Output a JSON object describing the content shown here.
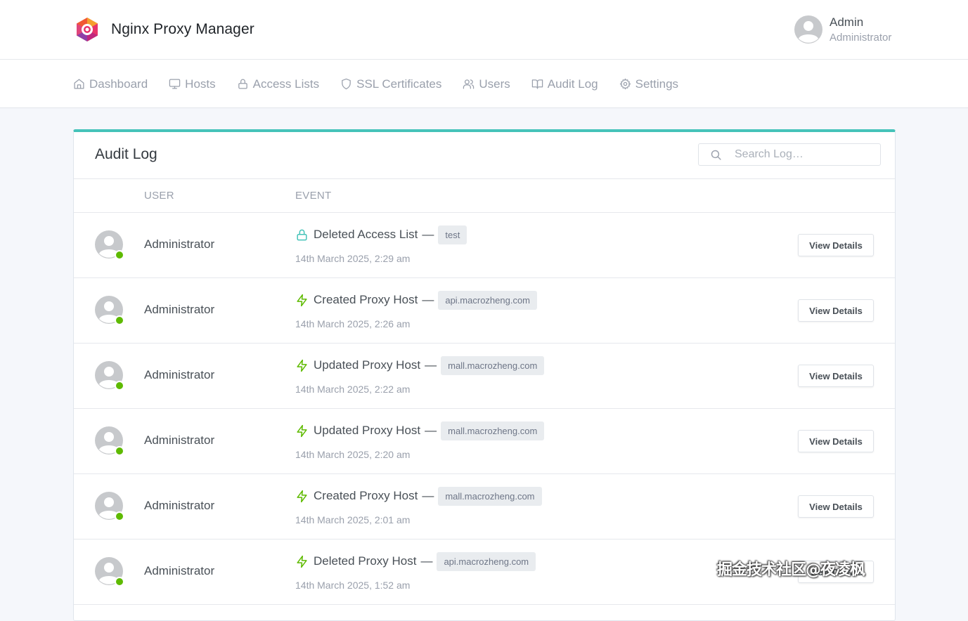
{
  "app": {
    "title": "Nginx Proxy Manager",
    "accent_color": "#45c3b9",
    "status_color": "#5eba00"
  },
  "user": {
    "name": "Admin",
    "role": "Administrator"
  },
  "nav": {
    "items": [
      {
        "label": "Dashboard",
        "icon": "home-icon"
      },
      {
        "label": "Hosts",
        "icon": "monitor-icon"
      },
      {
        "label": "Access Lists",
        "icon": "lock-icon"
      },
      {
        "label": "SSL Certificates",
        "icon": "shield-icon"
      },
      {
        "label": "Users",
        "icon": "users-icon"
      },
      {
        "label": "Audit Log",
        "icon": "book-icon"
      },
      {
        "label": "Settings",
        "icon": "gear-icon"
      }
    ]
  },
  "card": {
    "title": "Audit Log",
    "search_placeholder": "Search Log…"
  },
  "table": {
    "columns": {
      "user": "User",
      "event": "Event"
    },
    "view_label": "View Details",
    "rows": [
      {
        "user": "Administrator",
        "action": "Deleted Access List",
        "sep": "—",
        "target": "test",
        "date": "14th March 2025, 2:29 am",
        "icon": "lock-icon"
      },
      {
        "user": "Administrator",
        "action": "Created Proxy Host",
        "sep": "—",
        "target": "api.macrozheng.com",
        "date": "14th March 2025, 2:26 am",
        "icon": "zap-icon"
      },
      {
        "user": "Administrator",
        "action": "Updated Proxy Host",
        "sep": "—",
        "target": "mall.macrozheng.com",
        "date": "14th March 2025, 2:22 am",
        "icon": "zap-icon"
      },
      {
        "user": "Administrator",
        "action": "Updated Proxy Host",
        "sep": "—",
        "target": "mall.macrozheng.com",
        "date": "14th March 2025, 2:20 am",
        "icon": "zap-icon"
      },
      {
        "user": "Administrator",
        "action": "Created Proxy Host",
        "sep": "—",
        "target": "mall.macrozheng.com",
        "date": "14th March 2025, 2:01 am",
        "icon": "zap-icon"
      },
      {
        "user": "Administrator",
        "action": "Deleted Proxy Host",
        "sep": "—",
        "target": "api.macrozheng.com",
        "date": "14th March 2025, 1:52 am",
        "icon": "zap-icon"
      }
    ]
  },
  "watermark": {
    "text": "掘金技术社区@夜凌枫"
  }
}
